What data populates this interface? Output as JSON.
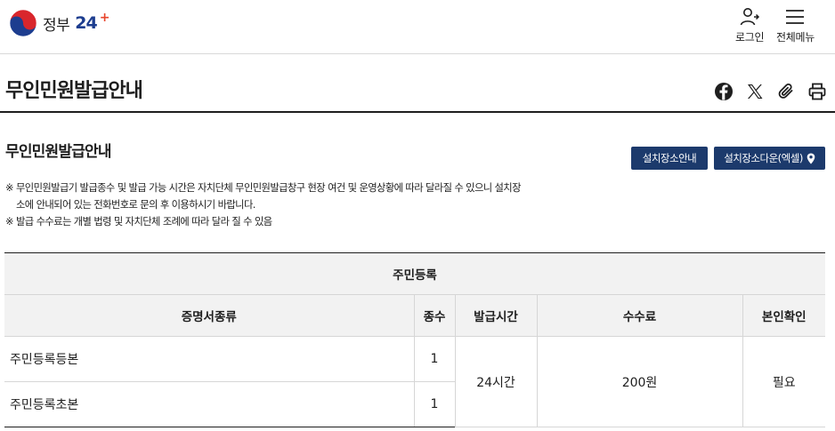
{
  "header": {
    "logo_text": "정부",
    "logo_number": "24",
    "logo_plus": "+",
    "login_label": "로그인",
    "menu_label": "전체메뉴"
  },
  "page": {
    "title": "무인민원발급안내"
  },
  "share": {
    "icons": [
      "facebook-icon",
      "x-icon",
      "link-icon",
      "print-icon"
    ]
  },
  "section": {
    "title": "무인민원발급안내",
    "btn_install_guide": "설치장소안내",
    "btn_install_download": "설치장소다운(엑셀)",
    "notes": [
      {
        "mark": "※",
        "text": "무인민원발급기 발급종수 및 발급 가능 시간은 자치단체 무인민원발급창구 현장 여건 및 운영상황에 따라 달라질 수 있으니 설치장"
      },
      {
        "mark": "",
        "text": "소에 안내되어 있는 전화번호로 문의 후 이용하시기 바랍니다."
      },
      {
        "mark": "※",
        "text": "발급 수수료는 개별 법령 및 자치단체 조례에 따라 달라 질 수 있음"
      }
    ]
  },
  "table": {
    "caption": "주민등록",
    "headers": [
      "증명서종류",
      "종수",
      "발급시간",
      "수수료",
      "본인확인"
    ],
    "rows": [
      {
        "name": "주민등록등본",
        "count": "1"
      },
      {
        "name": "주민등록초본",
        "count": "1"
      }
    ],
    "shared": {
      "time": "24시간",
      "fee": "200원",
      "verify": "필요"
    }
  },
  "colors": {
    "button_bg": "#1c3a6c",
    "logo_blue": "#1d3d8f",
    "logo_red": "#e8452c",
    "table_header_bg": "#f2f2f2"
  }
}
